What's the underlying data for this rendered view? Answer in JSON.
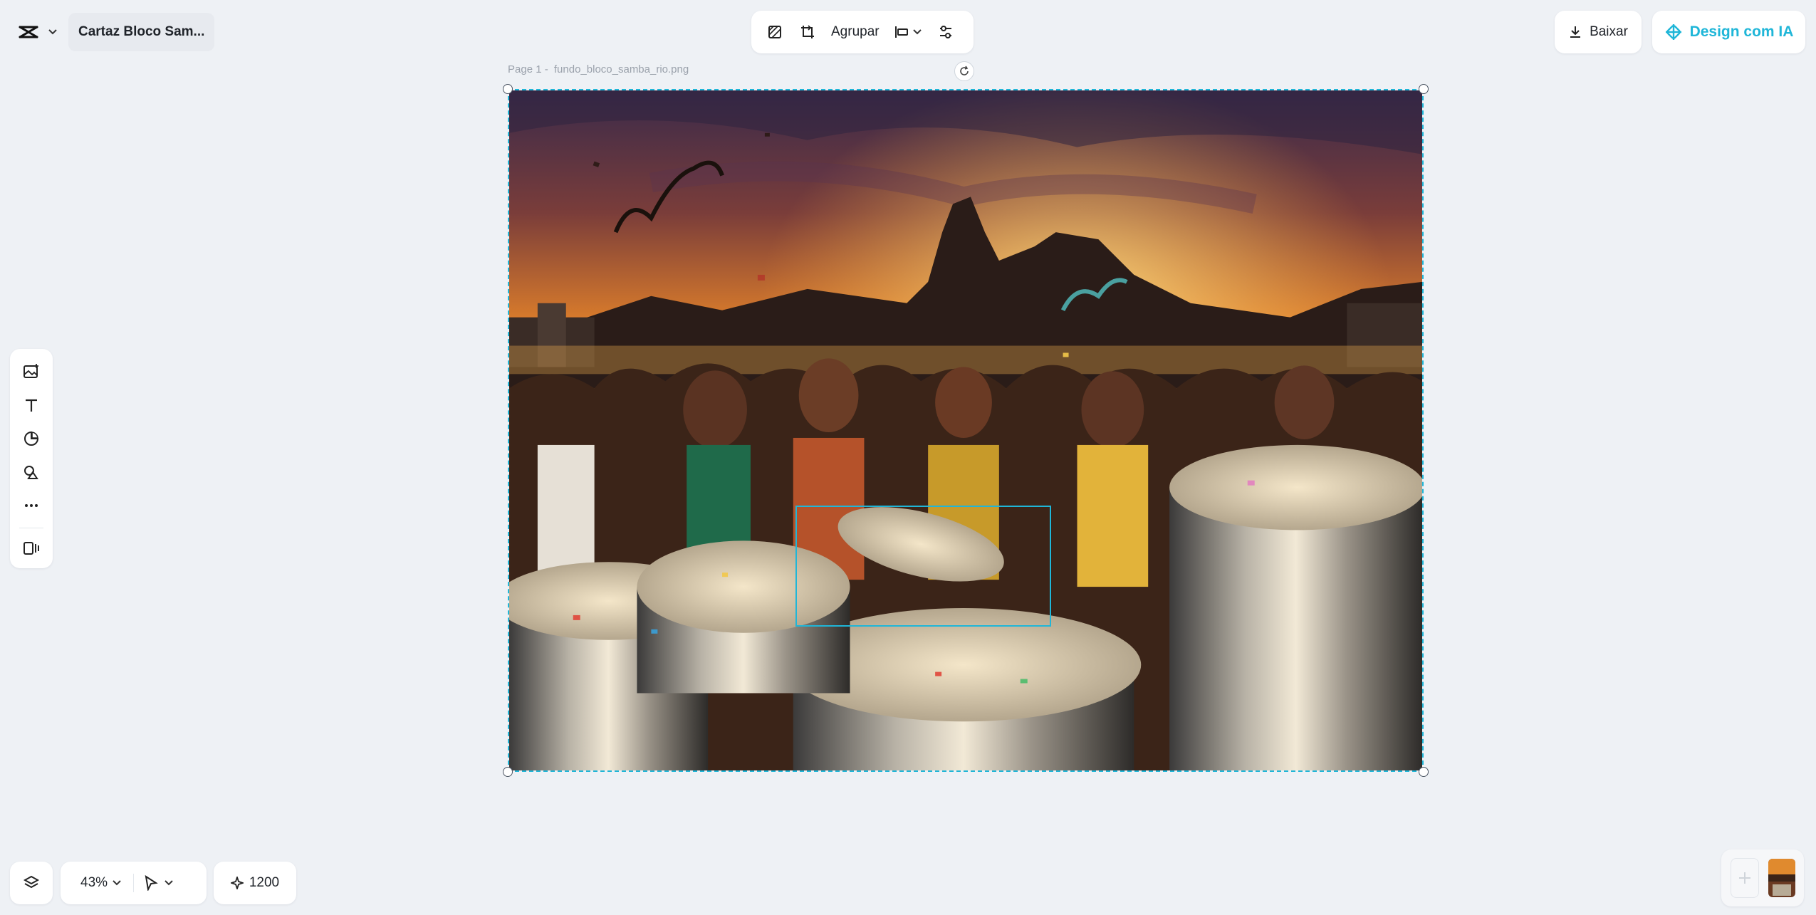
{
  "header": {
    "document_title": "Cartaz Bloco Sam...",
    "logo_icon": "capcut-logo-icon"
  },
  "toolbar": {
    "group_label": "Agrupar"
  },
  "actions": {
    "download_label": "Baixar",
    "ai_design_label": "Design com IA",
    "accent_color": "#1fb6d8"
  },
  "canvas": {
    "page_prefix": "Page 1 -",
    "file_name": "fundo_bloco_samba_rio.png"
  },
  "left_tools": [
    "upload-image-icon",
    "text-icon",
    "sticker-icon",
    "shapes-icon",
    "more-icon",
    "plugins-icon"
  ],
  "footer": {
    "zoom_value": "43%",
    "credits_value": "1200"
  }
}
